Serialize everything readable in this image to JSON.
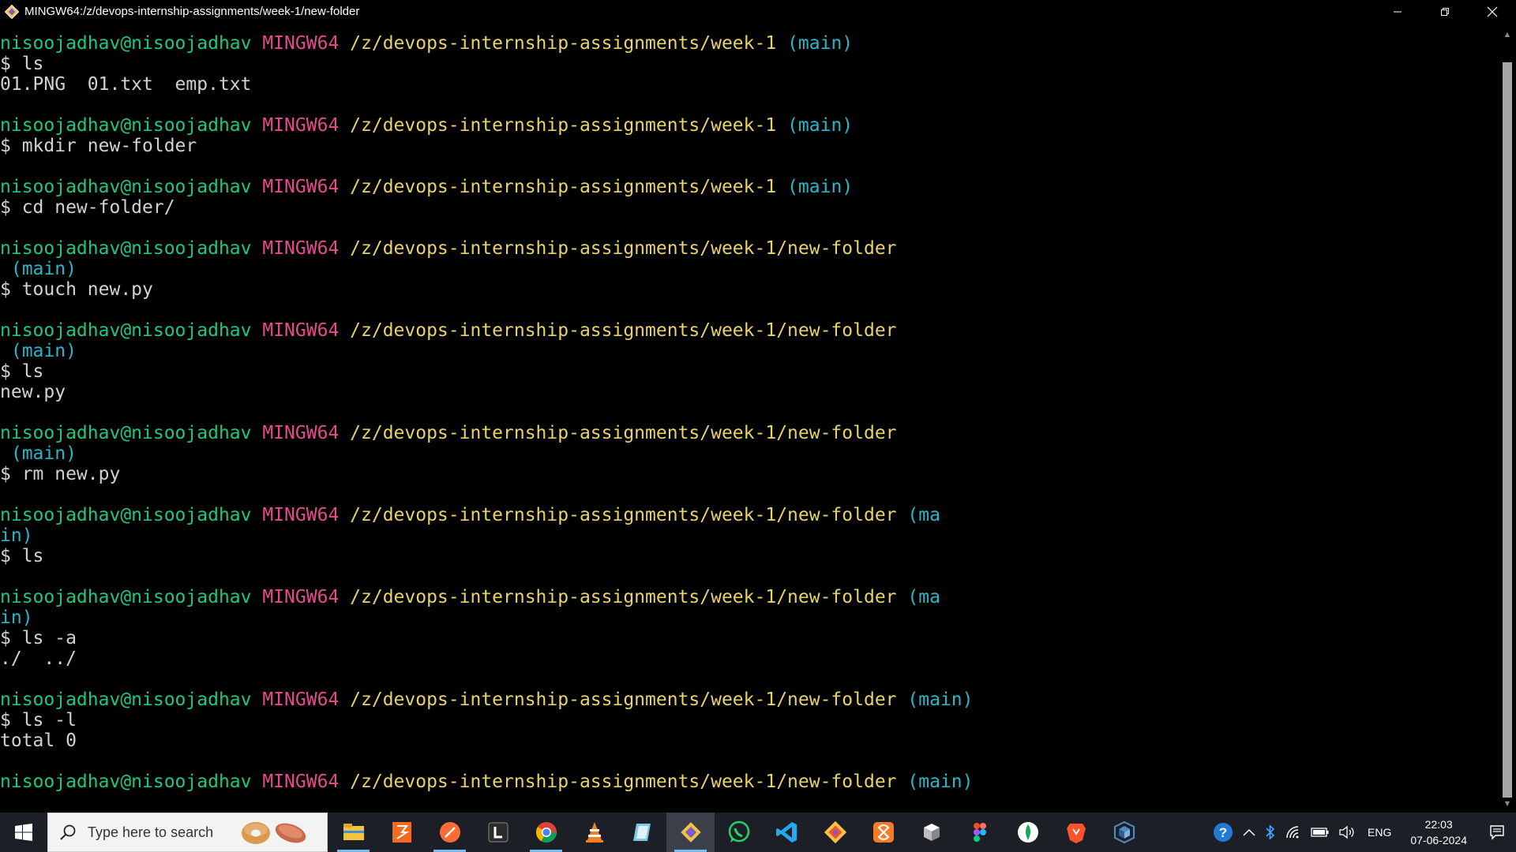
{
  "window": {
    "title": "MINGW64:/z/devops-internship-assignments/week-1/new-folder"
  },
  "terminal": {
    "lines": [
      [
        {
          "t": "nisoojadhav@nisoojadhav",
          "c": "u"
        },
        {
          "t": " ",
          "c": "t"
        },
        {
          "t": "MINGW64",
          "c": "h"
        },
        {
          "t": " ",
          "c": "t"
        },
        {
          "t": "/z/devops-internship-assignments/week-1",
          "c": "p"
        },
        {
          "t": " ",
          "c": "t"
        },
        {
          "t": "(main)",
          "c": "b"
        }
      ],
      [
        {
          "t": "$ ls",
          "c": "t"
        }
      ],
      [
        {
          "t": "01.PNG  01.txt  emp.txt",
          "c": "t"
        }
      ],
      [],
      [
        {
          "t": "nisoojadhav@nisoojadhav",
          "c": "u"
        },
        {
          "t": " ",
          "c": "t"
        },
        {
          "t": "MINGW64",
          "c": "h"
        },
        {
          "t": " ",
          "c": "t"
        },
        {
          "t": "/z/devops-internship-assignments/week-1",
          "c": "p"
        },
        {
          "t": " ",
          "c": "t"
        },
        {
          "t": "(main)",
          "c": "b"
        }
      ],
      [
        {
          "t": "$ mkdir new-folder",
          "c": "t"
        }
      ],
      [],
      [
        {
          "t": "nisoojadhav@nisoojadhav",
          "c": "u"
        },
        {
          "t": " ",
          "c": "t"
        },
        {
          "t": "MINGW64",
          "c": "h"
        },
        {
          "t": " ",
          "c": "t"
        },
        {
          "t": "/z/devops-internship-assignments/week-1",
          "c": "p"
        },
        {
          "t": " ",
          "c": "t"
        },
        {
          "t": "(main)",
          "c": "b"
        }
      ],
      [
        {
          "t": "$ cd new-folder/",
          "c": "t"
        }
      ],
      [],
      [
        {
          "t": "nisoojadhav@nisoojadhav",
          "c": "u"
        },
        {
          "t": " ",
          "c": "t"
        },
        {
          "t": "MINGW64",
          "c": "h"
        },
        {
          "t": " ",
          "c": "t"
        },
        {
          "t": "/z/devops-internship-assignments/week-1/new-folder",
          "c": "p"
        }
      ],
      [
        {
          "t": " (main)",
          "c": "b"
        }
      ],
      [
        {
          "t": "$ touch new.py",
          "c": "t"
        }
      ],
      [],
      [
        {
          "t": "nisoojadhav@nisoojadhav",
          "c": "u"
        },
        {
          "t": " ",
          "c": "t"
        },
        {
          "t": "MINGW64",
          "c": "h"
        },
        {
          "t": " ",
          "c": "t"
        },
        {
          "t": "/z/devops-internship-assignments/week-1/new-folder",
          "c": "p"
        }
      ],
      [
        {
          "t": " (main)",
          "c": "b"
        }
      ],
      [
        {
          "t": "$ ls",
          "c": "t"
        }
      ],
      [
        {
          "t": "new.py",
          "c": "t"
        }
      ],
      [],
      [
        {
          "t": "nisoojadhav@nisoojadhav",
          "c": "u"
        },
        {
          "t": " ",
          "c": "t"
        },
        {
          "t": "MINGW64",
          "c": "h"
        },
        {
          "t": " ",
          "c": "t"
        },
        {
          "t": "/z/devops-internship-assignments/week-1/new-folder",
          "c": "p"
        }
      ],
      [
        {
          "t": " (main)",
          "c": "b"
        }
      ],
      [
        {
          "t": "$ rm new.py",
          "c": "t"
        }
      ],
      [],
      [
        {
          "t": "nisoojadhav@nisoojadhav",
          "c": "u"
        },
        {
          "t": " ",
          "c": "t"
        },
        {
          "t": "MINGW64",
          "c": "h"
        },
        {
          "t": " ",
          "c": "t"
        },
        {
          "t": "/z/devops-internship-assignments/week-1/new-folder",
          "c": "p"
        },
        {
          "t": " ",
          "c": "t"
        },
        {
          "t": "(ma",
          "c": "b"
        }
      ],
      [
        {
          "t": "in)",
          "c": "b"
        }
      ],
      [
        {
          "t": "$ ls",
          "c": "t"
        }
      ],
      [],
      [
        {
          "t": "nisoojadhav@nisoojadhav",
          "c": "u"
        },
        {
          "t": " ",
          "c": "t"
        },
        {
          "t": "MINGW64",
          "c": "h"
        },
        {
          "t": " ",
          "c": "t"
        },
        {
          "t": "/z/devops-internship-assignments/week-1/new-folder",
          "c": "p"
        },
        {
          "t": " ",
          "c": "t"
        },
        {
          "t": "(ma",
          "c": "b"
        }
      ],
      [
        {
          "t": "in)",
          "c": "b"
        }
      ],
      [
        {
          "t": "$ ls -a",
          "c": "t"
        }
      ],
      [
        {
          "t": "./  ../",
          "c": "t"
        }
      ],
      [],
      [
        {
          "t": "nisoojadhav@nisoojadhav",
          "c": "u"
        },
        {
          "t": " ",
          "c": "t"
        },
        {
          "t": "MINGW64",
          "c": "h"
        },
        {
          "t": " ",
          "c": "t"
        },
        {
          "t": "/z/devops-internship-assignments/week-1/new-folder",
          "c": "p"
        },
        {
          "t": " ",
          "c": "t"
        },
        {
          "t": "(main)",
          "c": "b"
        }
      ],
      [
        {
          "t": "$ ls -l",
          "c": "t"
        }
      ],
      [
        {
          "t": "total 0",
          "c": "t"
        }
      ],
      [],
      [
        {
          "t": "nisoojadhav@nisoojadhav",
          "c": "u"
        },
        {
          "t": " ",
          "c": "t"
        },
        {
          "t": "MINGW64",
          "c": "h"
        },
        {
          "t": " ",
          "c": "t"
        },
        {
          "t": "/z/devops-internship-assignments/week-1/new-folder",
          "c": "p"
        },
        {
          "t": " ",
          "c": "t"
        },
        {
          "t": "(main)",
          "c": "b"
        }
      ]
    ]
  },
  "taskbar": {
    "search_placeholder": "Type here to search",
    "apps": [
      {
        "name": "file-explorer-icon",
        "color": "#f3c33c"
      },
      {
        "name": "pdf-reader-icon",
        "color": "#f36b21"
      },
      {
        "name": "postman-icon",
        "color": "#ff6c37"
      },
      {
        "name": "lens-icon",
        "color": "#2b2b2b"
      },
      {
        "name": "chrome-icon",
        "color": "#4285f4"
      },
      {
        "name": "vlc-icon",
        "color": "#f58220"
      },
      {
        "name": "notepad-icon",
        "color": "#7fc6e8"
      },
      {
        "name": "git-bash-icon",
        "color": "#f05133"
      },
      {
        "name": "whatsapp-icon",
        "color": "#25d366"
      },
      {
        "name": "vscode-icon",
        "color": "#23a9f2"
      },
      {
        "name": "git-icon",
        "color": "#f05133"
      },
      {
        "name": "xampp-icon",
        "color": "#fb7a24"
      },
      {
        "name": "virtualbox-cube-icon",
        "color": "#ffffff"
      },
      {
        "name": "figma-icon",
        "color": "#a259ff"
      },
      {
        "name": "mongodb-compass-icon",
        "color": "#13aa52"
      },
      {
        "name": "brave-icon",
        "color": "#fb542b"
      },
      {
        "name": "virtualbox-icon",
        "color": "#4f8cc9"
      }
    ],
    "tray": {
      "language": "ENG",
      "time": "22:03",
      "date": "07-06-2024"
    }
  }
}
